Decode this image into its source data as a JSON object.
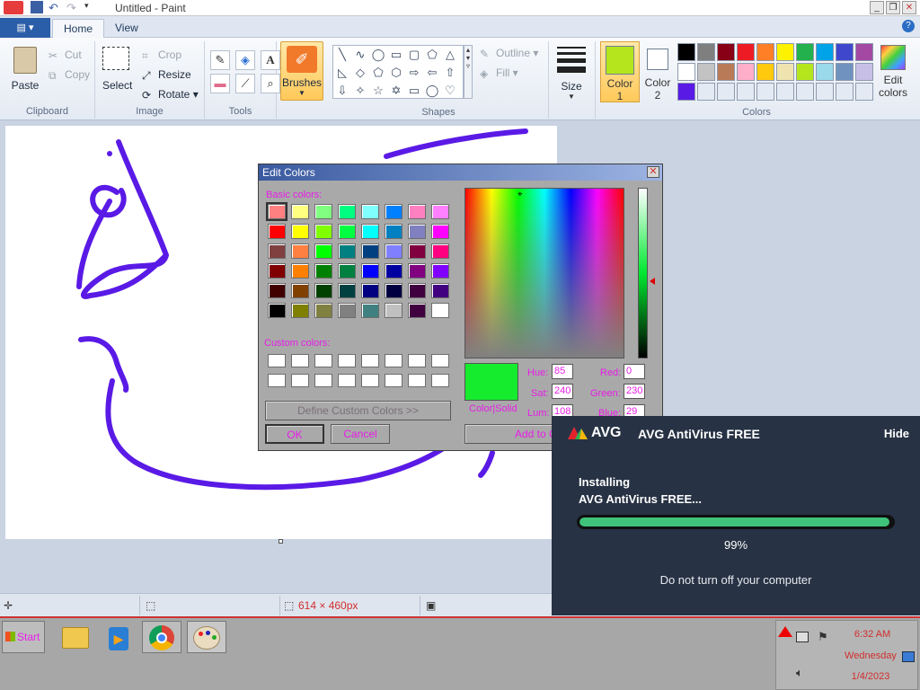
{
  "window": {
    "title": "Untitled - Paint"
  },
  "tabs": [
    {
      "label": "Home"
    },
    {
      "label": "View"
    }
  ],
  "ribbon": {
    "clipboard": {
      "label": "Clipboard",
      "paste": "Paste",
      "cut": "Cut",
      "copy": "Copy"
    },
    "image": {
      "label": "Image",
      "select": "Select",
      "crop": "Crop",
      "resize": "Resize",
      "rotate": "Rotate"
    },
    "tools": {
      "label": "Tools"
    },
    "brushes": {
      "label": "Brushes"
    },
    "shapes": {
      "label": "Shapes",
      "outline": "Outline",
      "fill": "Fill"
    },
    "size": {
      "label": "Size"
    },
    "colors": {
      "label": "Colors",
      "color1_line1": "Color",
      "color1_line2": "1",
      "color2_line1": "Color",
      "color2_line2": "2",
      "edit_line1": "Edit",
      "edit_line2": "colors",
      "color1_value": "#b5e61d",
      "color2_value": "#ffffff",
      "palette": [
        "#000000",
        "#7f7f7f",
        "#880015",
        "#ed1c24",
        "#ff7f27",
        "#fff200",
        "#22b14c",
        "#00a2e8",
        "#3f48cc",
        "#a349a4",
        "#ffffff",
        "#c3c3c3",
        "#b97a57",
        "#ffaec9",
        "#ffc90e",
        "#efe4b0",
        "#b5e61d",
        "#99d9ea",
        "#7092be",
        "#c8bfe7",
        "#5a1ae6",
        "#e4eaf3",
        "#e4eaf3",
        "#e4eaf3",
        "#e4eaf3",
        "#e4eaf3",
        "#e4eaf3",
        "#e4eaf3",
        "#e4eaf3",
        "#e4eaf3"
      ]
    }
  },
  "statusbar": {
    "size": "614 × 460px"
  },
  "dialog": {
    "title": "Edit Colors",
    "basic_label": "Basic colors:",
    "custom_label": "Custom colors:",
    "define_btn": "Define Custom Colors >>",
    "ok": "OK",
    "cancel": "Cancel",
    "add": "Add to C",
    "color_solid": "Color|Solid",
    "hue_label": "Hue:",
    "sat_label": "Sat:",
    "lum_label": "Lum:",
    "red_label": "Red:",
    "green_label": "Green:",
    "blue_label": "Blue:",
    "hue": "85",
    "sat": "240",
    "lum": "108",
    "red": "0",
    "green": "230",
    "blue": "29",
    "basic_colors": [
      "#ff8080",
      "#ffff80",
      "#80ff80",
      "#00ff80",
      "#80ffff",
      "#0080ff",
      "#ff80c0",
      "#ff80ff",
      "#ff0000",
      "#ffff00",
      "#80ff00",
      "#00ff40",
      "#00ffff",
      "#0080c0",
      "#8080c0",
      "#ff00ff",
      "#804040",
      "#ff8040",
      "#00ff00",
      "#008080",
      "#004080",
      "#8080ff",
      "#800040",
      "#ff0080",
      "#800000",
      "#ff8000",
      "#008000",
      "#008040",
      "#0000ff",
      "#0000a0",
      "#800080",
      "#8000ff",
      "#400000",
      "#804000",
      "#004000",
      "#004040",
      "#000080",
      "#000040",
      "#400040",
      "#400080",
      "#000000",
      "#808000",
      "#808040",
      "#808080",
      "#408080",
      "#c0c0c0",
      "#400040",
      "#ffffff"
    ]
  },
  "avg": {
    "brand": "AVG",
    "title": "AVG AntiVirus FREE",
    "hide": "Hide",
    "line1": "Installing",
    "line2": "AVG AntiVirus FREE...",
    "progress": 99,
    "percent": "99%",
    "note": "Do not turn off your computer"
  },
  "taskbar": {
    "start": "Start",
    "time": "6:32 AM",
    "day": "Wednesday",
    "date": "1/4/2023"
  }
}
